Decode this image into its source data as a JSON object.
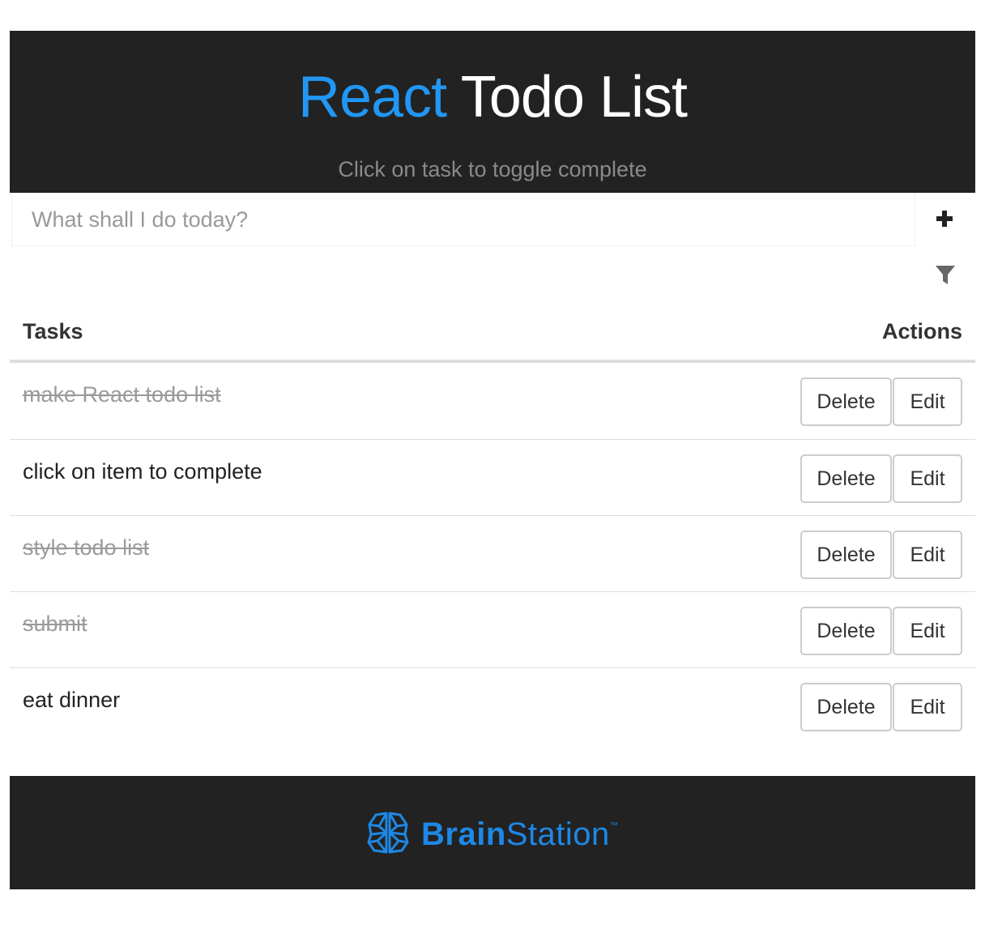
{
  "header": {
    "title_accent": "React",
    "title_rest": " Todo List",
    "subtitle": "Click on task to toggle complete"
  },
  "new_task": {
    "placeholder": "What shall I do today?",
    "add_icon": "plus-icon"
  },
  "filter": {
    "icon": "filter-icon"
  },
  "table": {
    "col_tasks": "Tasks",
    "col_actions": "Actions"
  },
  "tasks": [
    {
      "text": "make React todo list",
      "completed": true,
      "delete_label": "Delete",
      "edit_label": "Edit"
    },
    {
      "text": "click on item to complete",
      "completed": false,
      "delete_label": "Delete",
      "edit_label": "Edit"
    },
    {
      "text": "style todo list",
      "completed": true,
      "delete_label": "Delete",
      "edit_label": "Edit"
    },
    {
      "text": "submit",
      "completed": true,
      "delete_label": "Delete",
      "edit_label": "Edit"
    },
    {
      "text": "eat dinner",
      "completed": false,
      "delete_label": "Delete",
      "edit_label": "Edit"
    }
  ],
  "footer": {
    "brand_bold": "Brain",
    "brand_light": "Station",
    "trademark": "™",
    "logo_icon": "brain-icon"
  },
  "colors": {
    "accent": "#2196f3",
    "header_bg": "#222222",
    "completed_text": "#9a9a9a"
  }
}
